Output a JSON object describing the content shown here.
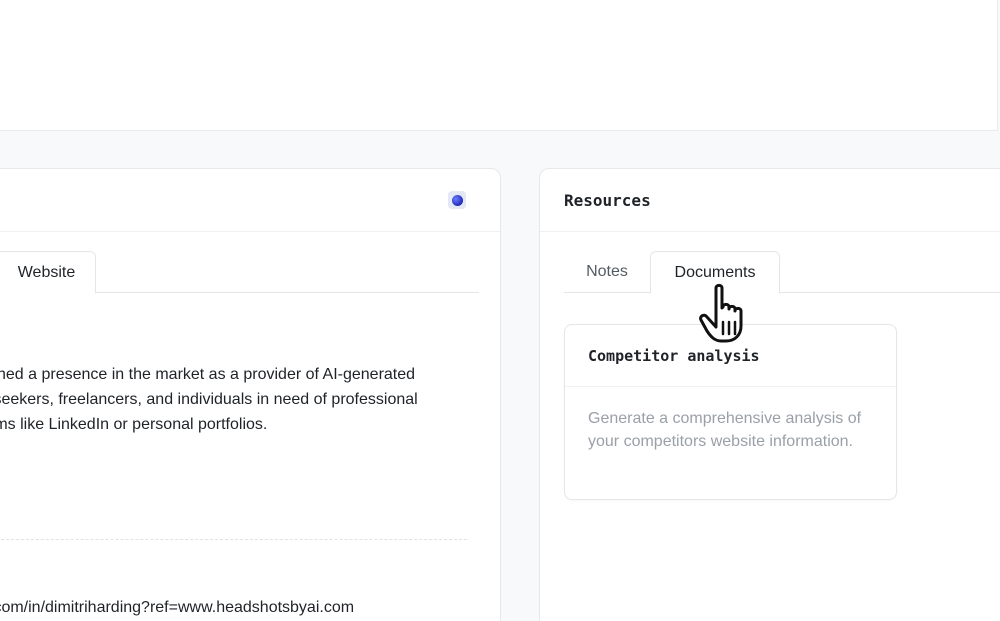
{
  "left_panel": {
    "tabs": [
      {
        "label": "Website",
        "active": true
      }
    ],
    "description_lines": [
      "shed a presence in the market as a provider of AI-generated",
      " seekers, freelancers, and individuals in need of professional",
      "rms like LinkedIn or personal portfolios."
    ],
    "link_fragment": "/",
    "url_fragment": ".com/in/dimitriharding?ref=www.headshotsbyai.com"
  },
  "resources": {
    "title": "Resources",
    "tabs": [
      {
        "label": "Notes",
        "active": false
      },
      {
        "label": "Documents",
        "active": true
      }
    ],
    "documents": [
      {
        "title": "Competitor analysis",
        "description": "Generate a comprehensive analysis of your competitors website information."
      }
    ]
  },
  "colors": {
    "accent_link": "#3aa3b3",
    "status_dot": "#1e2bb8",
    "muted_text": "#9aa0a7"
  },
  "icons": {
    "status": "status-dot-icon",
    "cursor": "hand-pointer-cursor-icon"
  }
}
